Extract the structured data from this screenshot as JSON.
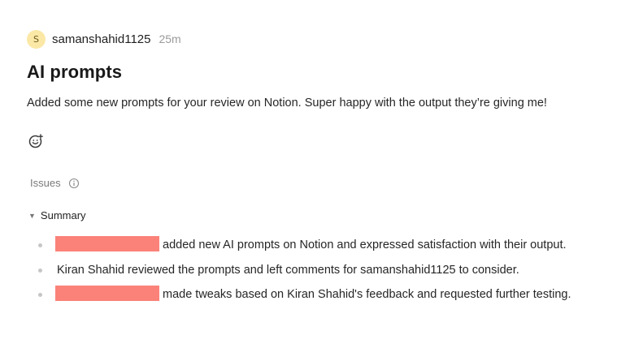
{
  "post": {
    "author": {
      "initial": "S",
      "name": "samanshahid1125",
      "timestamp": "25m"
    },
    "title": "AI prompts",
    "body": "Added some new prompts for your review on Notion. Super happy with the output they’re giving me!",
    "reaction_icon": "add-reaction-smiley-icon"
  },
  "issues": {
    "label": "Issues",
    "icon": "info-icon"
  },
  "summary": {
    "label": "Summary",
    "expanded": true,
    "items": [
      {
        "redacted": true,
        "text": "added new AI prompts on Notion and expressed satisfaction with their output."
      },
      {
        "redacted": false,
        "text": "Kiran Shahid reviewed the prompts and left comments for samanshahid1125 to consider."
      },
      {
        "redacted": true,
        "text": "made tweaks based on Kiran Shahid's feedback and requested further testing."
      }
    ]
  },
  "colors": {
    "avatar_bg": "#fbe8a6",
    "redaction": "#fb8279",
    "muted_text": "#9a9a9a"
  }
}
